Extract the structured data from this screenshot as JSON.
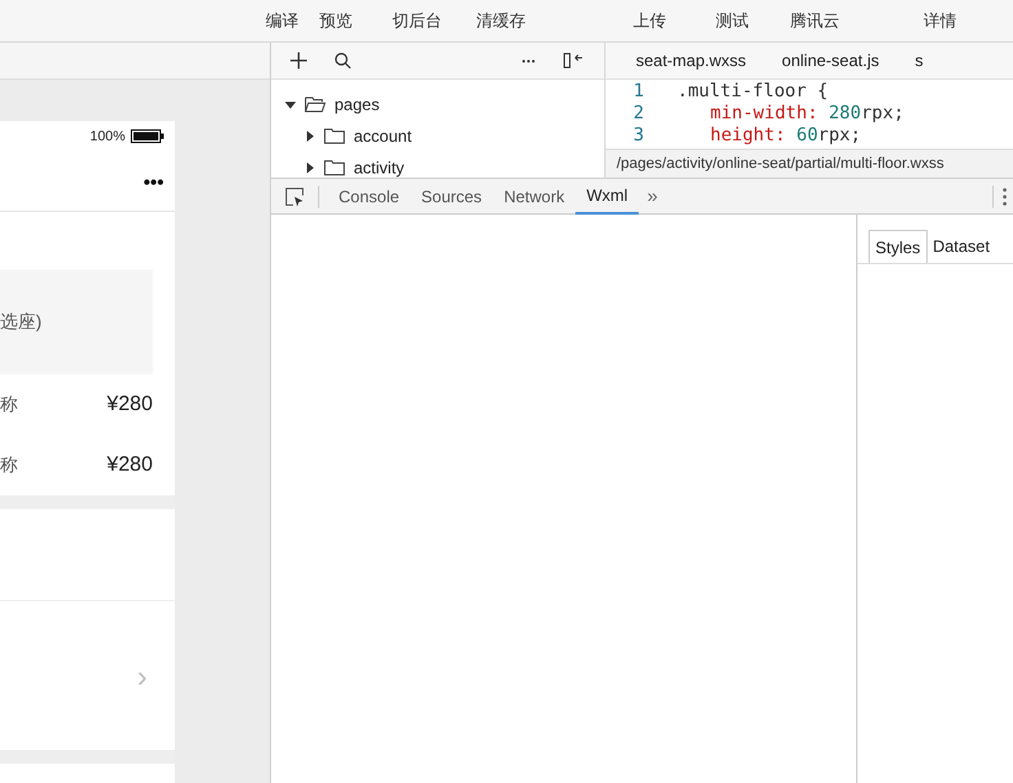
{
  "toolbar": {
    "buttons": [
      {
        "label": "编译"
      },
      {
        "label": "预览"
      },
      {
        "label": "切后台"
      },
      {
        "label": "清缓存"
      },
      {
        "label": "上传"
      },
      {
        "label": "测试"
      },
      {
        "label": "腾讯云"
      },
      {
        "label": "详情"
      }
    ]
  },
  "phone": {
    "battery": "100%",
    "menu": "•••",
    "section_label": "选座)",
    "rows": [
      {
        "name": "称",
        "price": "¥280"
      },
      {
        "name": "称",
        "price": "¥280"
      }
    ],
    "chevron": "›"
  },
  "file_tree": {
    "items": [
      {
        "label": "pages",
        "expanded": true,
        "children": [
          {
            "label": "account",
            "expanded": false
          },
          {
            "label": "activity",
            "expanded": false
          }
        ]
      }
    ]
  },
  "editor": {
    "tabs": [
      {
        "label": "seat-map.wxss",
        "selected": false
      },
      {
        "label": "online-seat.js",
        "selected": false
      },
      {
        "label": "s",
        "selected": false
      }
    ],
    "lines": [
      {
        "number": "1",
        "tokens": [
          {
            "kind": "selector",
            "text": ".multi-floor {"
          }
        ]
      },
      {
        "number": "2",
        "tokens": [
          {
            "kind": "property",
            "text": "min-width:"
          },
          {
            "kind": "number",
            "text": " 280"
          },
          {
            "kind": "plain",
            "text": "rpx;"
          }
        ]
      },
      {
        "number": "3",
        "tokens": [
          {
            "kind": "property",
            "text": "height:"
          },
          {
            "kind": "number",
            "text": " 60"
          },
          {
            "kind": "plain",
            "text": "rpx;"
          }
        ]
      }
    ],
    "path": "/pages/activity/online-seat/partial/multi-floor.wxss"
  },
  "devtools": {
    "tabs": [
      {
        "label": "Console",
        "selected": false
      },
      {
        "label": "Sources",
        "selected": false
      },
      {
        "label": "Network",
        "selected": false
      },
      {
        "label": "Wxml",
        "selected": true
      }
    ],
    "more": "»",
    "side_tabs": [
      {
        "label": "Styles",
        "selected": true
      },
      {
        "label": "Dataset",
        "selected": false
      }
    ]
  }
}
